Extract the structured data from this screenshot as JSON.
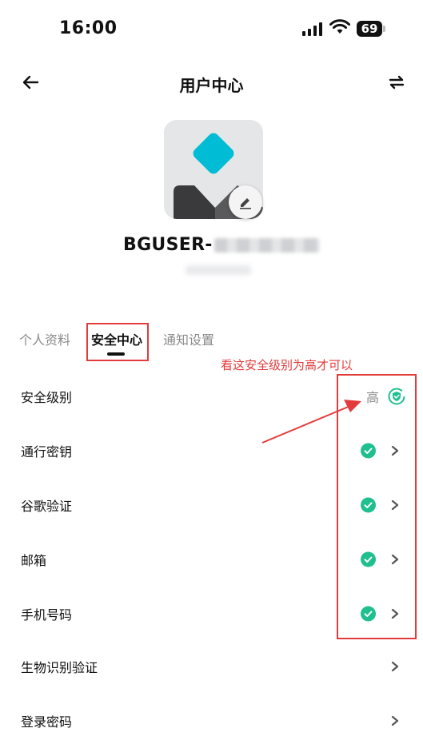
{
  "status_bar": {
    "time": "16:00",
    "battery": "69"
  },
  "nav": {
    "title": "用户中心"
  },
  "profile": {
    "username": "BGUSER-"
  },
  "tabs": [
    {
      "label": "个人资料",
      "active": false
    },
    {
      "label": "安全中心",
      "active": true
    },
    {
      "label": "通知设置",
      "active": false
    }
  ],
  "annotation": {
    "text": "看这安全级别为高才可以",
    "color": "#e23b3b"
  },
  "security": {
    "level_label": "安全级别",
    "level_value": "高",
    "items": [
      {
        "label": "通行密钥",
        "verified": true
      },
      {
        "label": "谷歌验证",
        "verified": true
      },
      {
        "label": "邮箱",
        "verified": true
      },
      {
        "label": "手机号码",
        "verified": true
      },
      {
        "label": "生物识别验证",
        "verified": false
      },
      {
        "label": "登录密码",
        "verified": false
      }
    ]
  },
  "colors": {
    "accent_green": "#1fbf8f",
    "logo_cyan": "#00bcd4",
    "annotation_red": "#e23b3b"
  }
}
